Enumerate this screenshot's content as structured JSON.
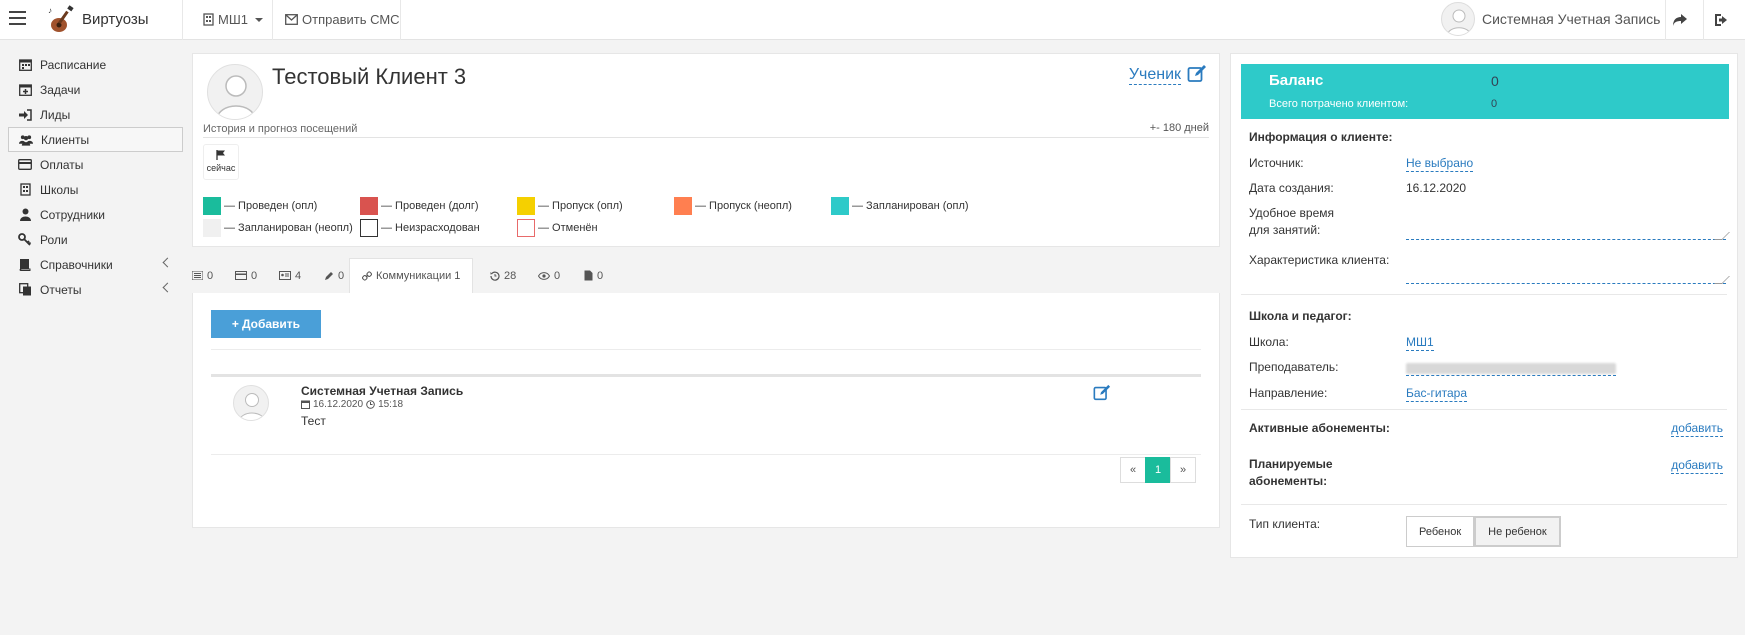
{
  "topbar": {
    "brand": "Виртуозы",
    "school": "МШ1",
    "send_sms": "Отправить СМС",
    "user": "Системная Учетная Запись"
  },
  "sidebar": {
    "items": [
      {
        "label": "Расписание",
        "icon": "calendar-icon"
      },
      {
        "label": "Задачи",
        "icon": "calendar-plus-icon"
      },
      {
        "label": "Лиды",
        "icon": "sign-in-icon"
      },
      {
        "label": "Клиенты",
        "icon": "users-icon"
      },
      {
        "label": "Оплаты",
        "icon": "credit-card-icon"
      },
      {
        "label": "Школы",
        "icon": "building-icon"
      },
      {
        "label": "Сотрудники",
        "icon": "user-icon"
      },
      {
        "label": "Роли",
        "icon": "key-icon"
      },
      {
        "label": "Справочники",
        "icon": "book-icon"
      },
      {
        "label": "Отчеты",
        "icon": "copy-icon"
      }
    ],
    "active": "Клиенты"
  },
  "client": {
    "name": "Тестовый Клиент 3",
    "role": "Ученик",
    "history_label": "История и прогноз посещений",
    "days_range": "+- 180 дней",
    "now_label": "сейчас"
  },
  "legend": [
    {
      "label": "Проведен (опл)",
      "color": "#1abc9c",
      "outline": false
    },
    {
      "label": "Проведен (долг)",
      "color": "#d9534f",
      "outline": false
    },
    {
      "label": "Пропуск (опл)",
      "color": "#f5d000",
      "outline": false
    },
    {
      "label": "Пропуск (неопл)",
      "color": "#ff7f50",
      "outline": false
    },
    {
      "label": "Запланирован (опл)",
      "color": "#2ecac9",
      "outline": false
    },
    {
      "label": "Запланирован (неопл)",
      "color": "#f0f0f0",
      "outline": false
    },
    {
      "label": "Неизрасходован",
      "color": "#ffffff",
      "outline": "#333333"
    },
    {
      "label": "Отменён",
      "color": "#ffffff",
      "outline": "#e86a6a"
    }
  ],
  "tabs": [
    {
      "label": "0",
      "icon": "list-icon"
    },
    {
      "label": "0",
      "icon": "card-icon"
    },
    {
      "label": "4",
      "icon": "id-card-icon"
    },
    {
      "label": "0",
      "icon": "pencil-icon"
    },
    {
      "label": "Коммуникации 1",
      "icon": "link-icon",
      "active": true
    },
    {
      "label": "28",
      "icon": "history-icon"
    },
    {
      "label": "0",
      "icon": "eye-icon"
    },
    {
      "label": "0",
      "icon": "file-icon"
    }
  ],
  "communications": {
    "add_label": "Добавить",
    "items": [
      {
        "author": "Системная Учетная Запись",
        "date": "16.12.2020",
        "time": "15:18",
        "text": "Тест"
      }
    ],
    "pager": {
      "prev": "«",
      "current": "1",
      "next": "»"
    }
  },
  "balance": {
    "label": "Баланс",
    "value": "0",
    "spent_label": "Всего потрачено клиентом:",
    "spent_value": "0"
  },
  "client_info": {
    "title": "Информация о клиенте:",
    "source_label": "Источник:",
    "source_value": "Не выбрано",
    "created_label": "Дата создания:",
    "created_value": "16.12.2020",
    "time_label_1": "Удобное время",
    "time_label_2": "для занятий:",
    "char_label": "Характеристика клиента:"
  },
  "school_teacher": {
    "title": "Школа и педагог:",
    "school_label": "Школа:",
    "school_value": "МШ1",
    "teacher_label": "Преподаватель:",
    "direction_label": "Направление:",
    "direction_value": "Бас-гитара"
  },
  "subscriptions": {
    "active_label": "Активные абонементы:",
    "planned_label_1": "Планируемые",
    "planned_label_2": "абонементы:",
    "add_label": "добавить"
  },
  "client_type": {
    "label": "Тип клиента:",
    "options": [
      "Ребенок",
      "Не ребенок"
    ],
    "selected": "Не ребенок"
  }
}
